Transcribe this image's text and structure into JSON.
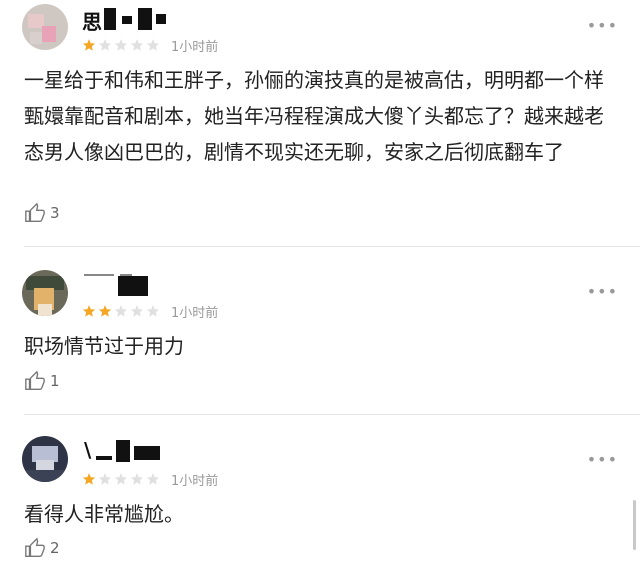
{
  "reviews": [
    {
      "name": "思",
      "stars": 1,
      "time": "1小时前",
      "text": "一星给于和伟和王胖子，孙俪的演技真的是被高估，明明都一个样甄嬛靠配音和剧本，她当年冯程程演成大傻丫头都忘了？越来越老态男人像凶巴巴的，剧情不现实还无聊，安家之后彻底翻车了",
      "likes": "3"
    },
    {
      "name": "",
      "stars": 2,
      "time": "1小时前",
      "text": "职场情节过于用力",
      "likes": "1"
    },
    {
      "name": "\\",
      "stars": 1,
      "time": "1小时前",
      "text": "看得人非常尴尬。",
      "likes": "2"
    }
  ],
  "more_glyph": "•••",
  "colors": {
    "star_filled": "#f5a623",
    "star_empty": "#e0e0e0"
  },
  "icons": {
    "like": "thumbs-up-icon",
    "more": "more-dots-icon",
    "star": "star-icon"
  }
}
